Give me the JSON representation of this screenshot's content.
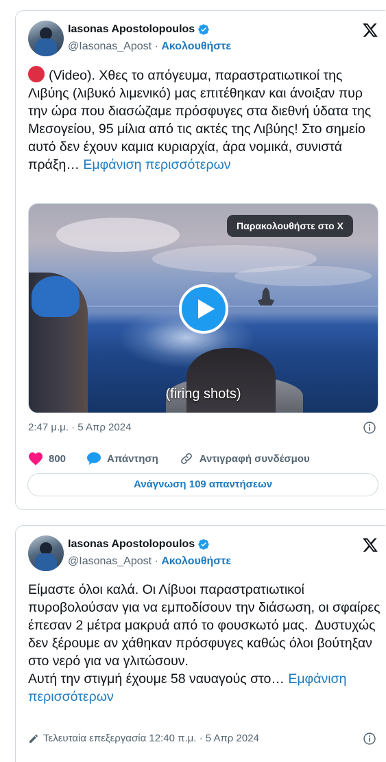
{
  "tweets": [
    {
      "author": {
        "name": "Iasonas Apostolopoulos",
        "handle": "@Iasonas_Apost",
        "separator": "·",
        "follow_label": "Ακολουθήστε"
      },
      "text": "(Video). Χθες το απόγευμα, παραστρατιωτικοί της Λιβύης (λιβυκό λιμενικό) μας επιτέθηκαν και άνοιξαν πυρ την ώρα που διασώζαμε πρόσφυγες στα διεθνή ύδατα της Μεσογείου, 95 μίλια από τις ακτές της Λιβύης! Στο σημείο αυτό δεν έχουν καμια κυριαρχία, άρα νομικά, συνιστά πράξη…",
      "show_more": "Εμφάνιση περισσότερων",
      "media": {
        "watch_label": "Παρακολουθήστε στο X",
        "caption": "(firing shots)"
      },
      "timestamp": "2:47 μ.μ. · 5 Απρ 2024",
      "likes": "800",
      "reply_label": "Απάντηση",
      "copy_link_label": "Αντιγραφή συνδέσμου",
      "read_replies_label": "Ανάγνωση 109 απαντήσεων"
    },
    {
      "author": {
        "name": "Iasonas Apostolopoulos",
        "handle": "@Iasonas_Apost",
        "separator": "·",
        "follow_label": "Ακολουθήστε"
      },
      "text": "Είμαστε όλοι καλά. Οι Λίβυοι παραστρατιωτικοί πυροβολούσαν για να εμποδίσουν την διάσωση, οι σφαίρες έπεσαν 2 μέτρα μακρυά από το φουσκωτό μας.  Δυστυχώς δεν ξέρουμε αν χάθηκαν πρόσφυγες καθώς όλοι βούτηξαν στο νερό για να γλιτώσουν.\nΑυτή την στιγμή έχουμε 58 ναυαγούς στο…",
      "show_more": "Εμφάνιση περισσότερων",
      "edited": "Τελευταία επεξεργασία 12:40 π.μ. · 5 Απρ 2024"
    }
  ],
  "colors": {
    "link": "#1d7bc1",
    "like": "#f91880",
    "reply": "#1d9bf0",
    "verified": "#1d9bf0",
    "text": "#0f1419",
    "muted": "#536471"
  },
  "icons": [
    "verified-badge-icon",
    "x-logo-icon",
    "play-icon",
    "info-icon",
    "heart-icon",
    "reply-icon",
    "link-icon",
    "edit-pencil-icon",
    "red-circle-emoji"
  ]
}
